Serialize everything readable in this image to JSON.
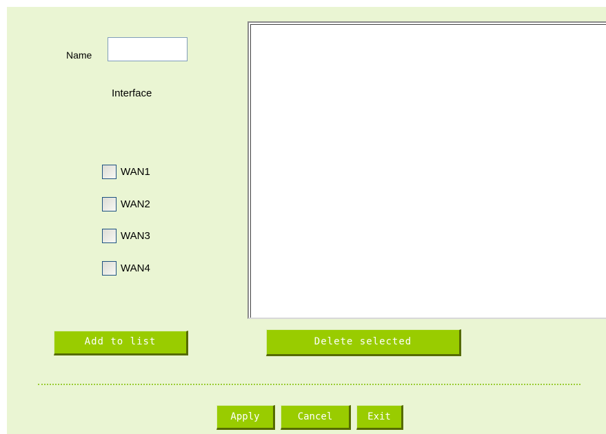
{
  "form": {
    "name_label": "Name",
    "name_value": "",
    "interface_label": "Interface",
    "interfaces": [
      {
        "label": "WAN1",
        "checked": false
      },
      {
        "label": "WAN2",
        "checked": false
      },
      {
        "label": "WAN3",
        "checked": false
      },
      {
        "label": "WAN4",
        "checked": false
      }
    ],
    "list_items": []
  },
  "buttons": {
    "add_to_list": "Add to list",
    "delete_selected": "Delete selected",
    "apply": "Apply",
    "cancel": "Cancel",
    "exit": "Exit"
  },
  "colors": {
    "panel_background": "#eaf5d3",
    "button_green": "#99cc00",
    "button_shadow": "#556b00",
    "divider": "#99cc33"
  }
}
